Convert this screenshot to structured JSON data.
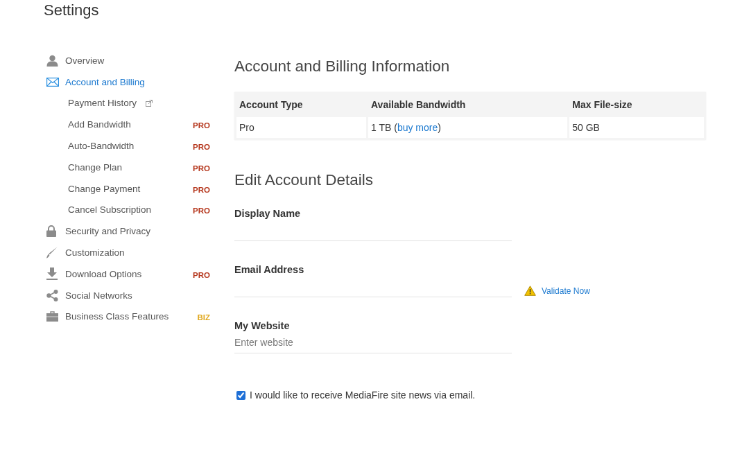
{
  "header": {
    "title": "Settings"
  },
  "sidebar": {
    "items": [
      {
        "label": "Overview",
        "selected": false
      },
      {
        "label": "Account and Billing",
        "selected": true,
        "children": [
          {
            "label": "Payment History",
            "selected": false,
            "external": true
          },
          {
            "label": "Add Bandwidth",
            "selected": false,
            "external": false,
            "badge": {
              "text": "PRO",
              "color": "#b5361c"
            }
          },
          {
            "label": "Auto-Bandwidth",
            "selected": false,
            "external": false,
            "badge": {
              "text": "PRO",
              "color": "#b5361c"
            }
          },
          {
            "label": "Change Plan",
            "selected": false,
            "external": false,
            "badge": {
              "text": "PRO",
              "color": "#b5361c"
            }
          },
          {
            "label": "Change Payment",
            "selected": false,
            "external": false,
            "badge": {
              "text": "PRO",
              "color": "#b5361c"
            }
          },
          {
            "label": "Cancel Subscription",
            "selected": false,
            "external": false,
            "badge": {
              "text": "PRO",
              "color": "#b5361c"
            }
          }
        ]
      },
      {
        "label": "Security and Privacy",
        "selected": false
      },
      {
        "label": "Customization",
        "selected": false
      },
      {
        "label": "Download Options",
        "selected": false,
        "badge": {
          "text": "PRO",
          "color": "#b5361c"
        }
      },
      {
        "label": "Social Networks",
        "selected": false
      },
      {
        "label": "Business Class Features",
        "selected": false,
        "badge": {
          "text": "BIZ",
          "color": "#e0a81e"
        }
      }
    ]
  },
  "billing": {
    "title": "Account and Billing Information",
    "table": {
      "columns": [
        "Account Type",
        "Available Bandwidth",
        "Max File-size"
      ],
      "rows": [
        [
          {
            "text": "Pro"
          },
          {
            "text": "1 TB (",
            "link": "buy more",
            "after": ")"
          },
          {
            "text": "50 GB"
          }
        ]
      ]
    }
  },
  "details": {
    "title": "Edit Account Details",
    "fields": [
      {
        "label": "Display Name"
      },
      {
        "label": "Email Address",
        "action": {
          "label": "Validate Now"
        }
      },
      {
        "label": "My Website",
        "placeholder": "Enter website"
      }
    ],
    "newsletter": {
      "label": "I would like to receive MediaFire site news via email.",
      "checked": true
    }
  }
}
